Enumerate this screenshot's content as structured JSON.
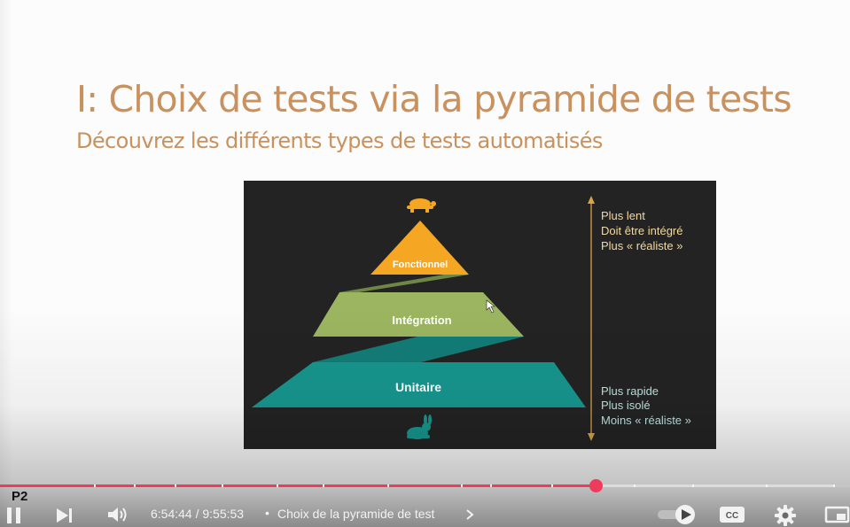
{
  "slide": {
    "title": "I: Choix de tests via la pyramide de tests",
    "subtitle": "Découvrez les différents types de tests automatisés"
  },
  "pyramid": {
    "levels": {
      "top": "Fonctionnel",
      "middle": "Intégration",
      "bottom": "Unitaire"
    },
    "top_notes": [
      "Plus lent",
      "Doit être intégré",
      "Plus « réaliste »"
    ],
    "bottom_notes": [
      "Plus rapide",
      "Plus isolé",
      "Moins « réaliste »"
    ],
    "top_icon": "turtle-icon",
    "bottom_icon": "rabbit-icon",
    "colors": {
      "top": "#f5a623",
      "middle": "#9cb560",
      "bottom": "#17968e",
      "background": "#232323",
      "arrow": "#d9a441"
    }
  },
  "player": {
    "chapter_marker": "P2",
    "current_time": "6:54:44",
    "duration": "9:55:53",
    "time_display": "6:54:44 / 9:55:53",
    "separator": "•",
    "chapter_title": "Choix de la pyramide de test",
    "progress_fraction": 0.7005,
    "accent_color": "#f03a5c",
    "icons": [
      "pause-icon",
      "next-icon",
      "volume-icon",
      "chevron-right-icon",
      "autoplay-toggle-icon",
      "captions-icon",
      "settings-icon",
      "miniplayer-icon"
    ],
    "captions_label": "CC"
  }
}
